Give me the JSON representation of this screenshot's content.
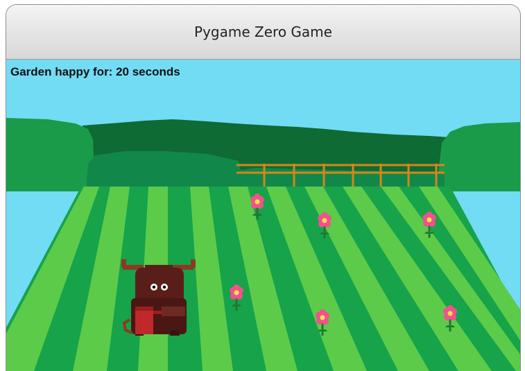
{
  "window": {
    "title": "Pygame Zero Game"
  },
  "hud": {
    "status_text": "Garden happy for: 20 seconds"
  },
  "colors": {
    "sky": "#72DCF5",
    "dark_hedge": "#0E6B33",
    "mid_hedge": "#11884A",
    "grass_dark": "#16A34A",
    "grass_light": "#5CCB4A",
    "fence": "#D7861A",
    "flower_petal": "#F0528C",
    "flower_center": "#FFE24A",
    "cow_body": "#5A1E1A",
    "watering_can": "#C0282B"
  },
  "sprites": {
    "player": "cow-with-watering-can",
    "flowers": [
      "flower",
      "flower",
      "flower",
      "flower",
      "flower",
      "flower"
    ]
  }
}
